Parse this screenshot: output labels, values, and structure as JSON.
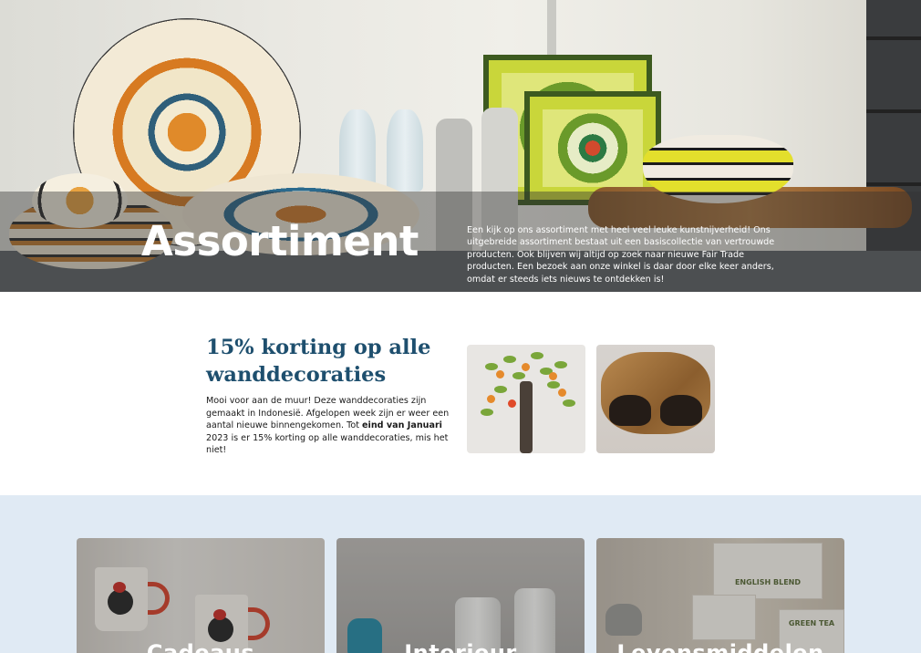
{
  "hero": {
    "title": "Assortiment",
    "intro": "Een kijk op ons assortiment met heel veel leuke kunstnijverheid! Ons uitgebreide assortiment bestaat uit een basiscollectie van vertrouwde producten. Ook blijven wij altijd op zoek naar nieuwe Fair Trade producten. Een bezoek aan onze winkel is daar door elke keer anders, omdat er steeds iets nieuws te ontdekken is!"
  },
  "promo": {
    "title": "15% korting op alle wanddecoraties",
    "text_before": "Mooi voor aan de muur! Deze wanddecoraties zijn gemaakt in Indonesië. Afgelopen week zijn er weer een aantal nieuwe binnengekomen. Tot ",
    "text_bold": "eind van Januari",
    "text_after": " 2023 is er 15% korting op alle wanddecoraties, mis het niet!"
  },
  "categories": [
    {
      "label": "Cadeaus"
    },
    {
      "label": "Interieur"
    },
    {
      "label": "Levensmiddelen"
    }
  ],
  "product_labels": {
    "tea_box": "ENGLISH BLEND",
    "green_tea": "GREEN TEA"
  },
  "colors": {
    "heading_blue": "#1e4f6e",
    "section_bg": "#e0eaf4"
  }
}
